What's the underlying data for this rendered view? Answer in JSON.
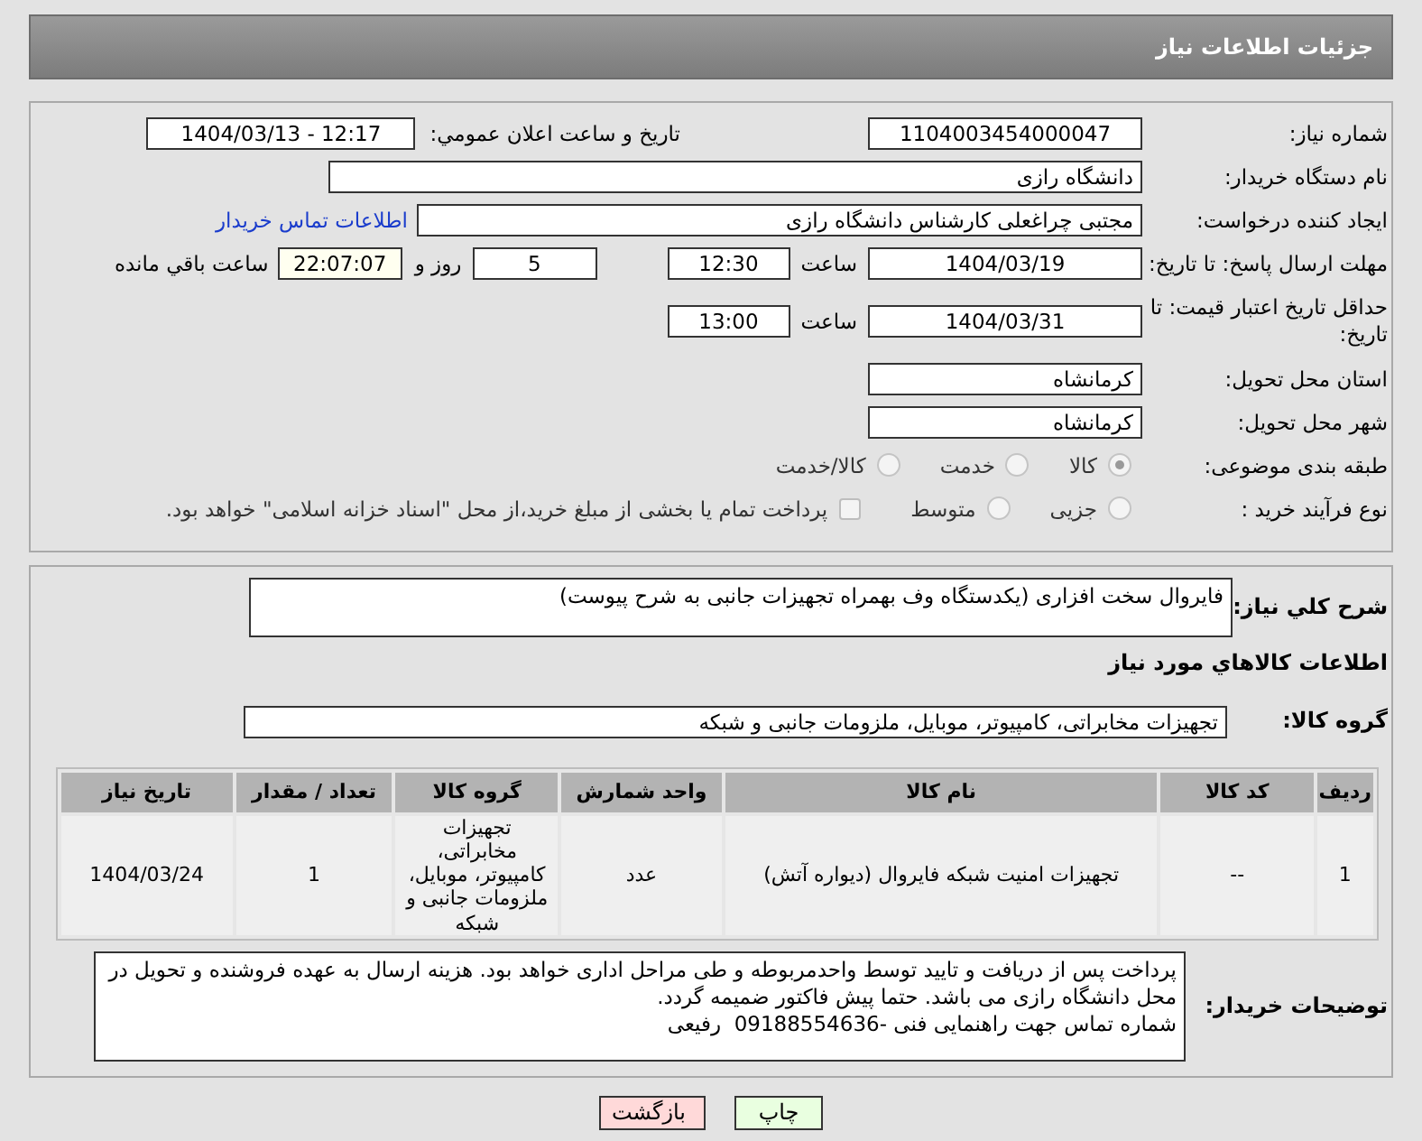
{
  "title": "جزئیات اطلاعات نیاز",
  "need_number": {
    "label": "شماره نیاز:",
    "value": "1104003454000047"
  },
  "announcement": {
    "label": "تاریخ و ساعت اعلان عمومي:",
    "value": "1404/03/13 - 12:17"
  },
  "buyer_org": {
    "label": "نام دستگاه خریدار:",
    "value": "دانشگاه رازی"
  },
  "requester": {
    "label": "ایجاد کننده درخواست:",
    "value": "مجتبی چراغعلی کارشناس دانشگاه رازی",
    "link": "اطلاعات تماس خریدار"
  },
  "reply_deadline": {
    "label": "مهلت ارسال پاسخ: تا تاریخ:",
    "date": "1404/03/19",
    "time_label": "ساعت",
    "time": "12:30",
    "days": "5",
    "days_label": "روز و",
    "remaining": "22:07:07",
    "remaining_label": "ساعت باقي مانده"
  },
  "price_validity": {
    "label": "حداقل تاریخ اعتبار قیمت: تا تاریخ:",
    "date": "1404/03/31",
    "time_label": "ساعت",
    "time": "13:00"
  },
  "province": {
    "label": "استان محل تحویل:",
    "value": "کرمانشاه"
  },
  "city": {
    "label": "شهر محل تحویل:",
    "value": "کرمانشاه"
  },
  "category": {
    "label": "طبقه بندی موضوعی:",
    "options": [
      {
        "label": "کالا",
        "selected": true
      },
      {
        "label": "خدمت",
        "selected": false
      },
      {
        "label": "کالا/خدمت",
        "selected": false
      }
    ]
  },
  "process": {
    "label": "نوع فرآیند خرید :",
    "options": [
      {
        "label": "جزیی",
        "selected": false
      },
      {
        "label": "متوسط",
        "selected": false
      }
    ],
    "payment": {
      "label": "پرداخت تمام یا بخشی از مبلغ خرید،از محل \"اسناد خزانه اسلامی\" خواهد بود.",
      "checked": false
    }
  },
  "description": {
    "label": "شرح کلي نیاز:",
    "value": "فایروال سخت افزاری (یکدستگاه وف بهمراه تجهیزات جانبی به شرح پیوست)"
  },
  "goods_heading": "اطلاعات کالاهاي مورد نیاز",
  "goods_group": {
    "label": "گروه کالا:",
    "value": "تجهیزات مخابراتی، کامپیوتر، موبایل، ملزومات جانبی و شبکه"
  },
  "table": {
    "columns": [
      "ردیف",
      "کد کالا",
      "نام کالا",
      "واحد شمارش",
      "گروه کالا",
      "تعداد / مقدار",
      "تاریخ نیاز"
    ],
    "rows": [
      [
        "1",
        "--",
        "تجهیزات امنیت شبکه فایروال (دیواره آتش)",
        "عدد",
        "تجهیزات مخابراتی، کامپیوتر، موبایل، ملزومات جانبی و شبکه",
        "1",
        "1404/03/24"
      ]
    ]
  },
  "buyer_notes": {
    "label": "توضیحات خریدار:",
    "value": "پرداخت پس از دریافت و تایید توسط واحدمربوطه و طی مراحل اداری خواهد بود. هزینه ارسال به عهده فروشنده و تحویل در محل دانشگاه رازی می باشد. حتما پیش فاکتور ضمیمه گردد.\nشماره تماس جهت راهنمایی فنی -09188554636  رفیعی"
  },
  "buttons": [
    {
      "label": "چاپ",
      "kind": "print"
    },
    {
      "label": "بازگشت",
      "kind": "back"
    }
  ]
}
